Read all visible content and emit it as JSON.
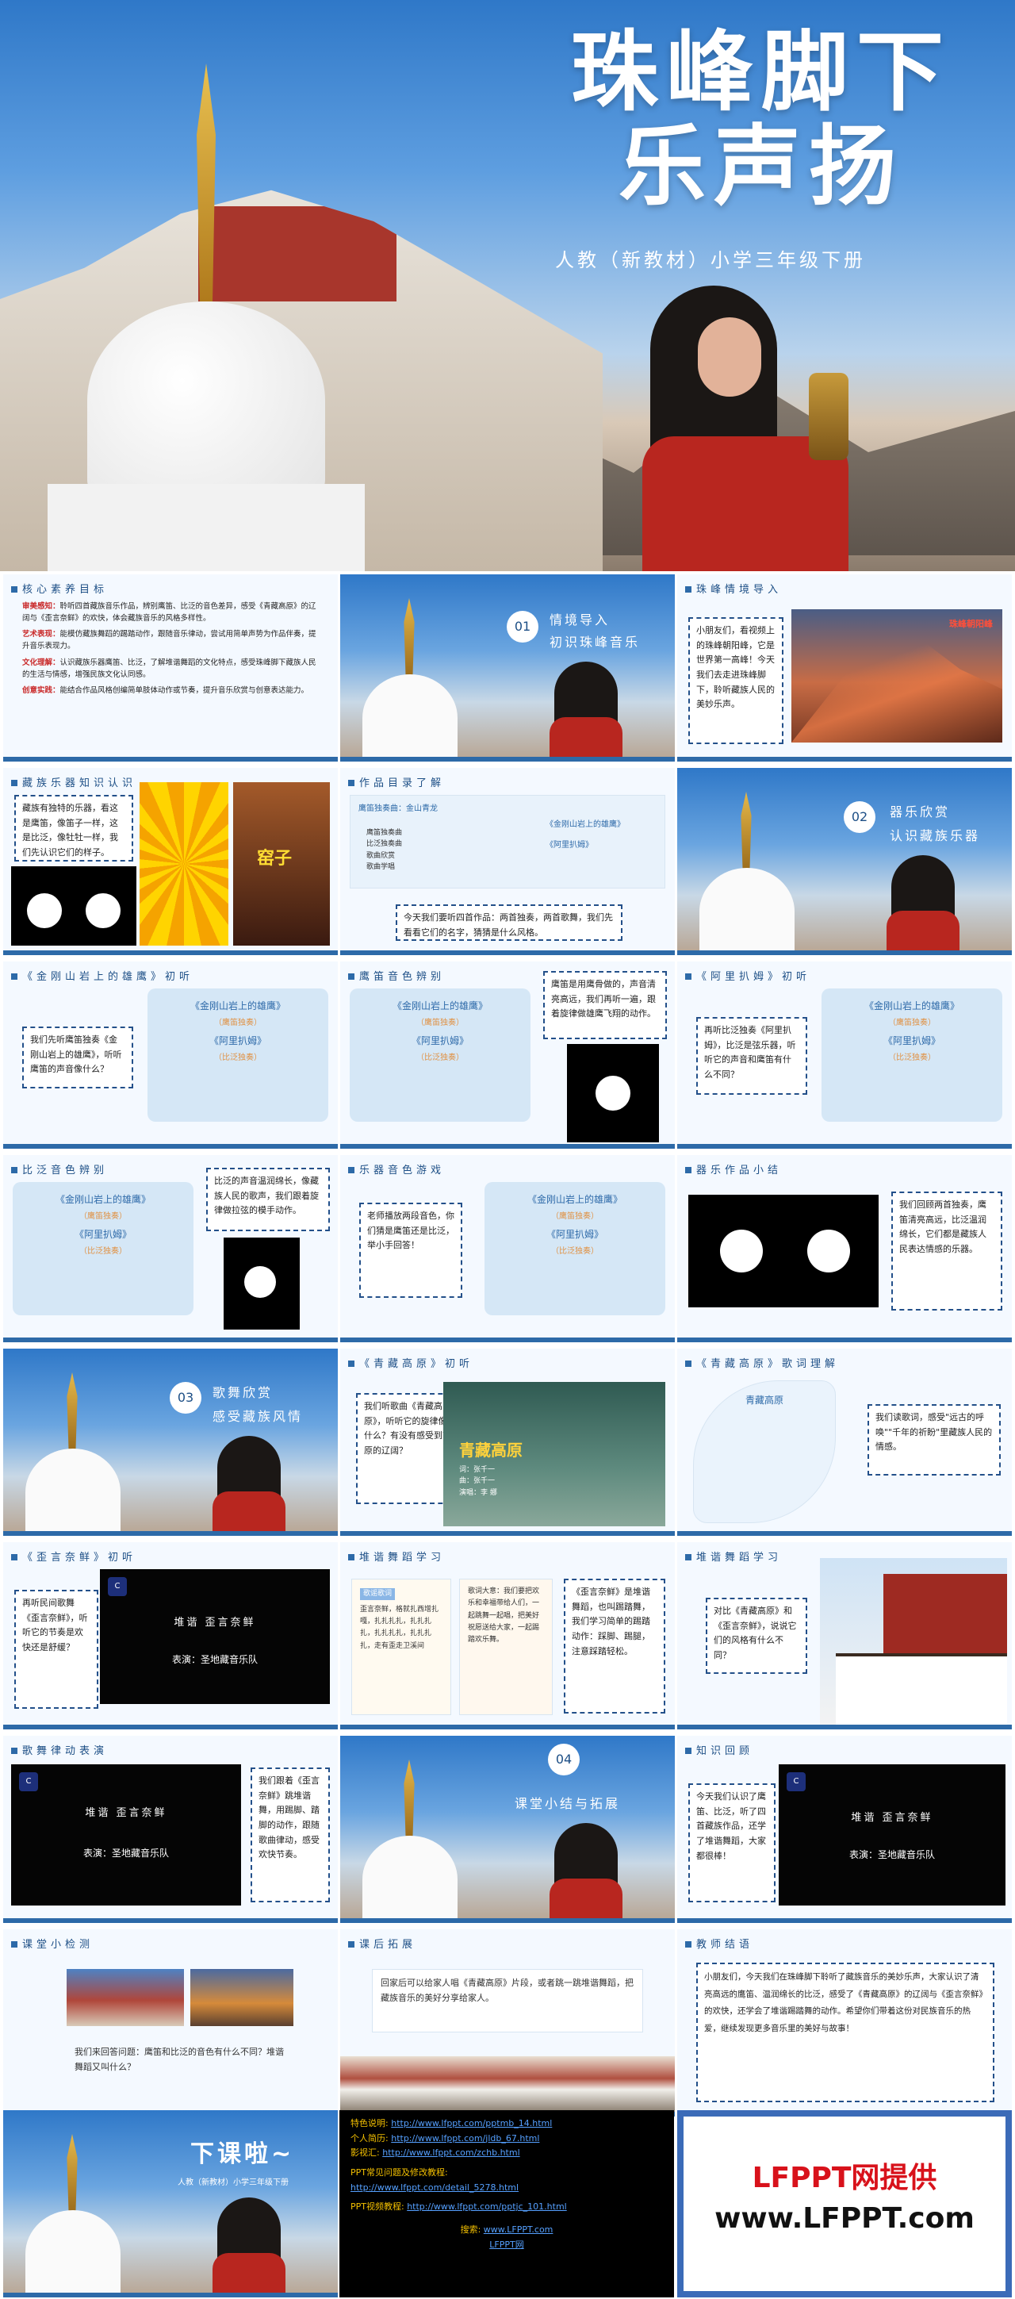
{
  "hero": {
    "title_line1": "珠峰脚下",
    "title_line2": "乐声扬",
    "subtitle": "人教（新教材）小学三年级下册"
  },
  "s1": {
    "header": "核心素养目标",
    "items": [
      {
        "label": "审美感知：",
        "text": "聆听四首藏族音乐作品，辨别鹰笛、比泛的音色差异，感受《青藏高原》的辽阔与《歪言奈鲜》的欢快，体会藏族音乐的风格多样性。"
      },
      {
        "label": "艺术表现：",
        "text": "能模仿藏族舞蹈的踢踏动作，跟随音乐律动，尝试用简单声势为作品伴奏，提升音乐表现力。"
      },
      {
        "label": "文化理解：",
        "text": "认识藏族乐器鹰笛、比泛，了解堆谐舞蹈的文化特点，感受珠峰脚下藏族人民的生活与情感，增强民族文化认同感。"
      },
      {
        "label": "创意实践：",
        "text": "能结合作品风格创编简单肢体动作或节奏，提升音乐欣赏与创意表达能力。"
      }
    ]
  },
  "s2": {
    "num": "01",
    "line1": "情境导入",
    "line2": "初识珠峰音乐"
  },
  "s3": {
    "header": "珠峰情境导入",
    "text": "小朋友们，看视频上的珠峰朝阳峰，它是世界第一高峰！今天我们去走进珠峰脚下，聆听藏族人民的美妙乐声。",
    "photo_label": "珠峰朝阳峰"
  },
  "s4": {
    "header": "藏族乐器知识认识",
    "text": "藏族有独特的乐器，看这是鹰笛，像笛子一样，这是比泛，像牡牡一样，我们先认识它们的样子。",
    "sticker": "窑子"
  },
  "s5": {
    "header": "作品目录了解",
    "panel_title": "鹰笛独奏曲：金山青龙",
    "list_a": [
      "鹰笛独奏曲",
      "比泛独奏曲",
      "歌曲欣赏",
      "歌曲学唱"
    ],
    "list_b": [
      "《金刚山岩上的雄鹰》",
      "《阿里扒姆》"
    ],
    "text": "今天我们要听四首作品：两首独奏，两首歌舞，我们先看看它们的名字，猜猜是什么风格。"
  },
  "s6": {
    "num": "02",
    "line1": "器乐欣赏",
    "line2": "认识藏族乐器"
  },
  "s7": {
    "header": "《金刚山岩上的雄鹰》初听",
    "text": "我们先听鹰笛独奏《金刚山岩上的雄鹰》，听听鹰笛的声音像什么？",
    "song1": "《金刚山岩上的雄鹰》",
    "sub1": "（鹰笛独奏）",
    "song2": "《阿里扒姆》",
    "sub2": "（比泛独奏）"
  },
  "s8": {
    "header": "鹰笛音色辨别",
    "text": "鹰笛是用鹰骨做的，声音清亮高远，我们再听一遍，跟着旋律做雄鹰飞翔的动作。",
    "song1": "《金刚山岩上的雄鹰》",
    "sub1": "（鹰笛独奏）",
    "song2": "《阿里扒姆》",
    "sub2": "（比泛独奏）"
  },
  "s9": {
    "header": "《阿里扒姆》初听",
    "text": "再听比泛独奏《阿里扒姆》，比泛是弦乐器，听听它的声音和鹰笛有什么不同？",
    "song1": "《金刚山岩上的雄鹰》",
    "sub1": "（鹰笛独奏）",
    "song2": "《阿里扒姆》",
    "sub2": "（比泛独奏）"
  },
  "s10": {
    "header": "比泛音色辨别",
    "text": "比泛的声音温润绵长，像藏族人民的歌声，我们跟着旋律做拉弦的模手动作。",
    "song1": "《金刚山岩上的雄鹰》",
    "sub1": "（鹰笛独奏）",
    "song2": "《阿里扒姆》",
    "sub2": "（比泛独奏）"
  },
  "s11": {
    "header": "乐器音色游戏",
    "text": "老师播放两段音色，你们猜是鹰笛还是比泛，举小手回答！",
    "song1": "《金刚山岩上的雄鹰》",
    "sub1": "（鹰笛独奏）",
    "song2": "《阿里扒姆》",
    "sub2": "（比泛独奏）"
  },
  "s12": {
    "header": "器乐作品小结",
    "text": "我们回顾两首独奏，鹰笛清亮高远，比泛温润绵长，它们都是藏族人民表达情感的乐器。"
  },
  "s13": {
    "num": "03",
    "line1": "歌舞欣赏",
    "line2": "感受藏族风情"
  },
  "s14": {
    "header": "《青藏高原》初听",
    "text": "我们听歌曲《青藏高原》，听听它的旋律像什么？有没有感受到高原的辽阔？",
    "mv_title": "青藏高原",
    "credits": [
      "词：张千一",
      "曲：张千一",
      "演唱：李 娜"
    ]
  },
  "s15": {
    "header": "《青藏高原》歌词理解",
    "poem_title": "青藏高原",
    "text": "我们读歌词，感受\"远古的呼唤\"\"千年的祈盼\"里藏族人民的情感。"
  },
  "s16": {
    "header": "《歪言奈鲜》初听",
    "text": "再听民间歌舞《歪言奈鲜》，听听它的节奏是欢快还是舒缓？",
    "mv_title": "堆谐  歪言奈鲜",
    "mv_caption": "表演：圣地藏音乐队"
  },
  "s17": {
    "header": "堆谐舞蹈学习",
    "label": "歌谣歌词",
    "lyric_text": "歪言奈鲜，格就扎西增扎嘎，扎扎扎扎，扎扎扎扎，扎扎扎扎，扎扎扎扎，走有歪走卫溪间",
    "note_text": "歌词大意：我们要把欢乐和幸福带给人们，一起跳舞一起唱，把美好祝愿送给大家，一起踢踏欢乐舞。",
    "text": "《歪言奈鲜》是堆谐舞蹈，也叫踢踏舞，我们学习简单的踢踏动作：踩脚、踢腿，注意踩踏轻松。"
  },
  "s18": {
    "header": "堆谐舞蹈学习",
    "text": "对比《青藏高原》和《歪言奈鲜》，说说它们的风格有什么不同？"
  },
  "s19": {
    "header": "歌舞律动表演",
    "mv_title": "堆谐  歪言奈鲜",
    "mv_caption": "表演：圣地藏音乐队",
    "text": "我们跟着《歪言奈鲜》跳堆谐舞，用踢脚、踏脚的动作，跟随歌曲律动，感受欢快节奏。"
  },
  "s20": {
    "num": "04",
    "line1": "课堂小结与拓展"
  },
  "s21": {
    "header": "知识回顾",
    "text": "今天我们认识了鹰笛、比泛，听了四首藏族作品，还学了堆谐舞蹈，大家都很棒！",
    "mv_title": "堆谐  歪言奈鲜",
    "mv_caption": "表演：圣地藏音乐队"
  },
  "s22": {
    "header": "课堂小检测",
    "text": "我们来回答问题：鹰笛和比泛的音色有什么不同？堆谐舞蹈又叫什么？"
  },
  "s23": {
    "header": "课后拓展",
    "text": "回家后可以给家人唱《青藏高原》片段，或者跳一跳堆谐舞蹈，把藏族音乐的美好分享给家人。"
  },
  "s24": {
    "header": "教师结语",
    "text": "小朋友们，今天我们在珠峰脚下聆听了藏族音乐的美妙乐声，大家认识了清亮高远的鹰笛、温润绵长的比泛，感受了《青藏高原》的辽阔与《歪言奈鲜》的欢快，还学会了堆谐踢踏舞的动作。希望你们带着这份对民族音乐的热爱，继续发现更多音乐里的美好与故事！"
  },
  "s25": {
    "title": "下课啦~",
    "sub": "人教（新教材）小学三年级下册"
  },
  "links": [
    {
      "key": "特色说明:",
      "url": "http://www.lfppt.com/pptmb_14.html"
    },
    {
      "key": "个人简历:",
      "url": "http://www.lfppt.com/jldb_67.html"
    },
    {
      "key": "影视汇:",
      "url": "http://www.lfppt.com/zchb.html"
    },
    {
      "key": "PPT常见问题及修改教程:",
      "url": "http://www.lfppt.com/detail_5278.html"
    },
    {
      "key": "PPT视频教程:",
      "url": "http://www.lfppt.com/pptjc_101.html"
    }
  ],
  "links_search_label": "搜索:",
  "links_search_url": "www.LFPPT.com",
  "links_footer": "LFPPT网",
  "endcard": {
    "line1": "LFPPT网提供",
    "line2": "www.LFPPT.com"
  }
}
